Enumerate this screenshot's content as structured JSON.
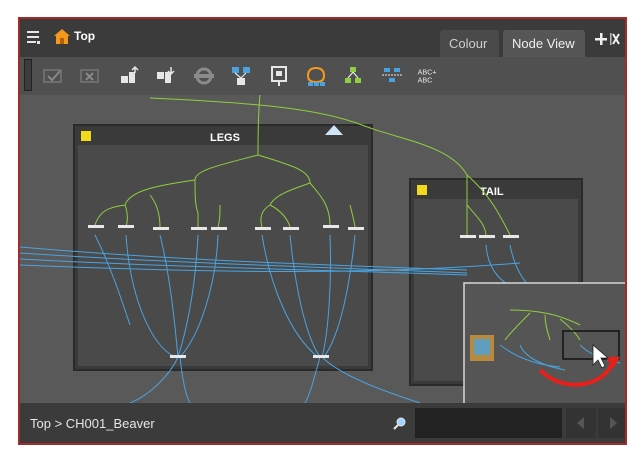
{
  "topbar": {
    "breadcrumb_root": "Top"
  },
  "tabs": [
    {
      "label": "Colour"
    },
    {
      "label": "Node View"
    }
  ],
  "groups": {
    "legs_label": "LEGS",
    "tail_label": "TAIL"
  },
  "status": {
    "breadcrumb": "Top > CH001_Beaver"
  },
  "toolbar": {
    "buttons": [
      "enable-icon",
      "disable-icon",
      "move-up-icon",
      "move-down-icon",
      "rotate-icon",
      "network-icon",
      "peg-icon",
      "mask-icon",
      "tree-icon",
      "arrange-icon",
      "text-case-icon"
    ],
    "text_button": "ABC+ABC"
  },
  "colors": {
    "frame_border": "#a12b2b",
    "node_wire_green": "#8fcf3d",
    "node_wire_blue": "#4aa3e0",
    "group_dot": "#f2d91a",
    "arrow_red": "#e8201a"
  }
}
